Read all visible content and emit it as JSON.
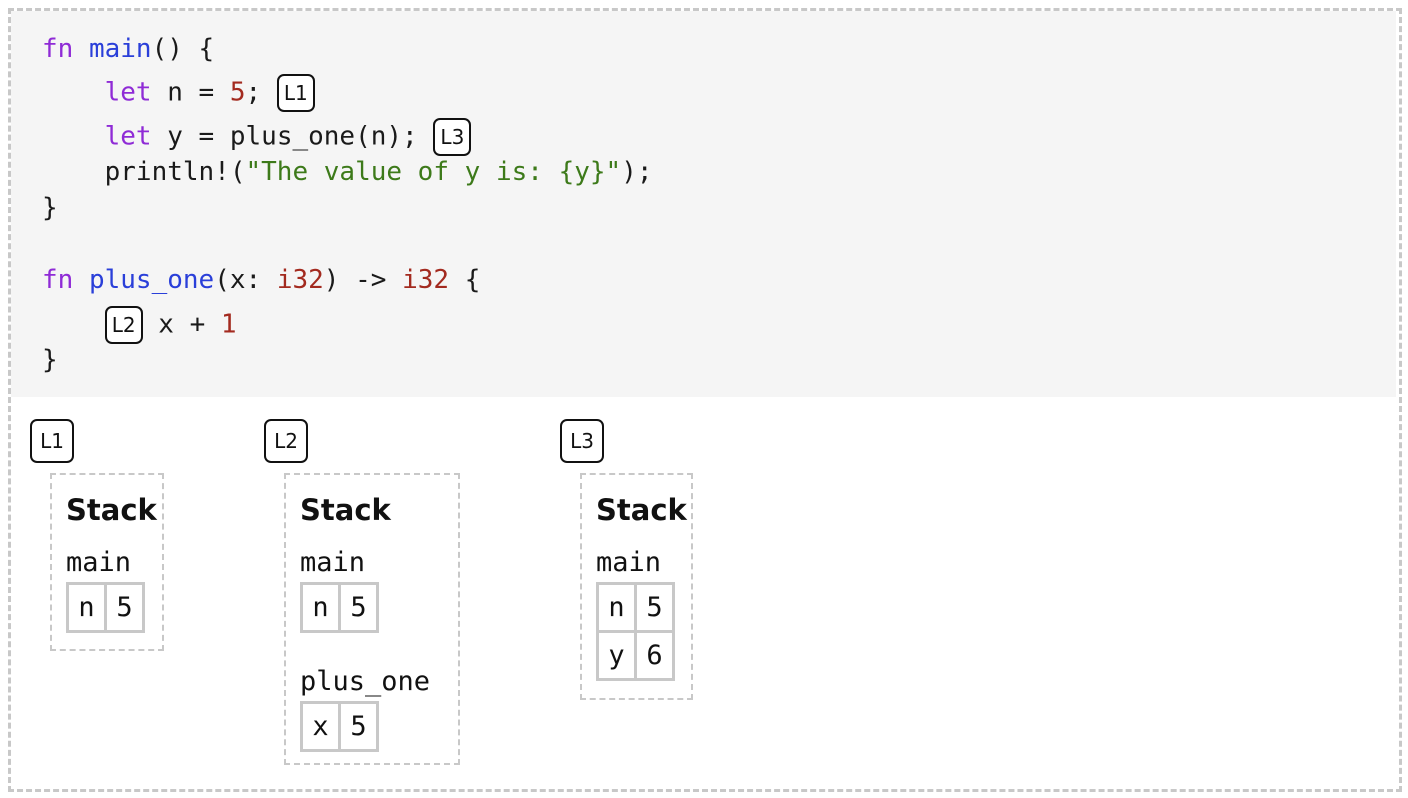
{
  "code": {
    "lines": [
      [
        {
          "t": "fn",
          "c": "kw"
        },
        {
          "t": " "
        },
        {
          "t": "main",
          "c": "fn"
        },
        {
          "t": "() {"
        }
      ],
      [
        {
          "t": "    "
        },
        {
          "t": "let",
          "c": "kw"
        },
        {
          "t": " n = "
        },
        {
          "t": "5",
          "c": "num"
        },
        {
          "t": "; "
        },
        {
          "lbl": "L1"
        }
      ],
      [
        {
          "t": "    "
        },
        {
          "t": "let",
          "c": "kw"
        },
        {
          "t": " y = plus_one(n); "
        },
        {
          "lbl": "L3"
        }
      ],
      [
        {
          "t": "    println!("
        },
        {
          "t": "\"The value of y is: {y}\"",
          "c": "str"
        },
        {
          "t": ");"
        }
      ],
      [
        {
          "t": "}"
        }
      ],
      [],
      [
        {
          "t": "fn",
          "c": "kw"
        },
        {
          "t": " "
        },
        {
          "t": "plus_one",
          "c": "fn"
        },
        {
          "t": "(x: "
        },
        {
          "t": "i32",
          "c": "num"
        },
        {
          "t": ") -> "
        },
        {
          "t": "i32",
          "c": "num"
        },
        {
          "t": " {"
        }
      ],
      [
        {
          "t": "    "
        },
        {
          "lbl": "L2"
        },
        {
          "t": " x + "
        },
        {
          "t": "1",
          "c": "num"
        }
      ],
      [
        {
          "t": "}"
        }
      ]
    ]
  },
  "steps": [
    {
      "label": "L1",
      "stack_title": "Stack",
      "frames": [
        {
          "name": "main",
          "vars": [
            {
              "k": "n",
              "v": "5"
            }
          ]
        }
      ]
    },
    {
      "label": "L2",
      "stack_title": "Stack",
      "frames": [
        {
          "name": "main",
          "vars": [
            {
              "k": "n",
              "v": "5"
            }
          ]
        },
        {
          "name": "plus_one",
          "vars": [
            {
              "k": "x",
              "v": "5"
            }
          ]
        }
      ]
    },
    {
      "label": "L3",
      "stack_title": "Stack",
      "frames": [
        {
          "name": "main",
          "vars": [
            {
              "k": "n",
              "v": "5"
            },
            {
              "k": "y",
              "v": "6"
            }
          ]
        }
      ]
    }
  ],
  "colors": {
    "keyword": "#8f2bd6",
    "function": "#2a3fd9",
    "number": "#a32a1f",
    "string": "#3d7a1a",
    "border": "#c8c8c8"
  }
}
